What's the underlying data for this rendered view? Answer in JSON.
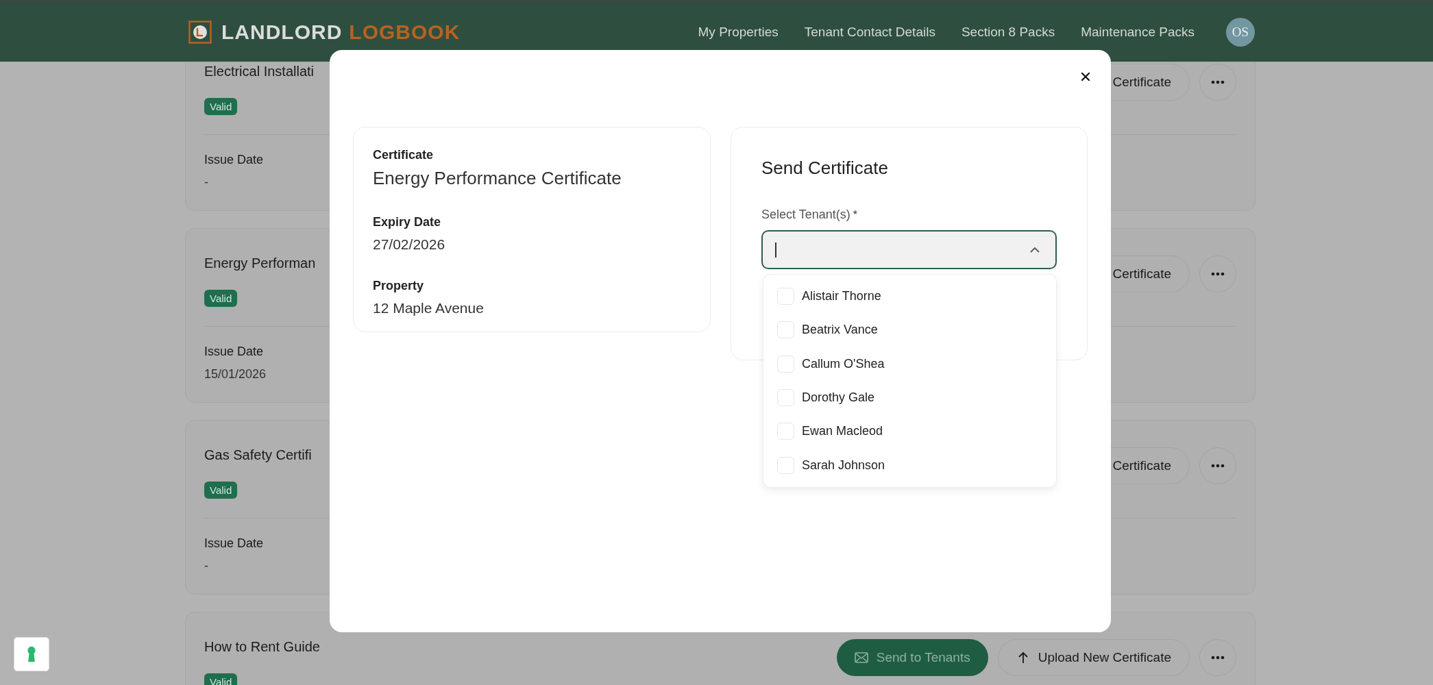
{
  "header": {
    "brand_first": "LANDLORD",
    "brand_second": "LOGBOOK",
    "nav": [
      "My Properties",
      "Tenant Contact Details",
      "Section 8 Packs",
      "Maintenance Packs"
    ],
    "avatar": "OS"
  },
  "certificate_cards": [
    {
      "title": "Electrical Installati",
      "status": "Valid",
      "issue_label": "Issue Date",
      "issue_date": "-",
      "actions": [
        {
          "kind": "partial",
          "label": "Certificate"
        }
      ]
    },
    {
      "title": "Energy Performan",
      "status": "Valid",
      "issue_label": "Issue Date",
      "issue_date": "15/01/2026",
      "actions": [
        {
          "kind": "partial",
          "label": "Certificate"
        }
      ]
    },
    {
      "title": "Gas Safety Certifi",
      "status": "Valid",
      "issue_label": "Issue Date",
      "issue_date": "-",
      "actions": [
        {
          "kind": "partial",
          "label": "Certificate"
        }
      ]
    },
    {
      "title": "How to Rent Guide",
      "status": "Valid",
      "actions": [
        {
          "kind": "send",
          "label": "Send to Tenants"
        },
        {
          "kind": "upload",
          "label": "Upload New Certificate"
        }
      ]
    }
  ],
  "modal": {
    "details": [
      {
        "label": "Certificate",
        "value": "Energy Performance Certificate",
        "kind": "title"
      },
      {
        "label": "Expiry Date",
        "value": "27/02/2026",
        "kind": "plain"
      },
      {
        "label": "Property",
        "value": "12 Maple Avenue",
        "kind": "plain"
      }
    ],
    "send_title": "Send Certificate",
    "select_label": "Select Tenant(s)",
    "required_mark": "*",
    "tenant_select": {
      "expanded": true,
      "options": [
        {
          "name": "Alistair Thorne",
          "checked": false
        },
        {
          "name": "Beatrix Vance",
          "checked": false
        },
        {
          "name": "Callum O'Shea",
          "checked": false
        },
        {
          "name": "Dorothy Gale",
          "checked": false
        },
        {
          "name": "Ewan Macleod",
          "checked": false
        },
        {
          "name": "Sarah Johnson",
          "checked": false
        }
      ]
    }
  }
}
